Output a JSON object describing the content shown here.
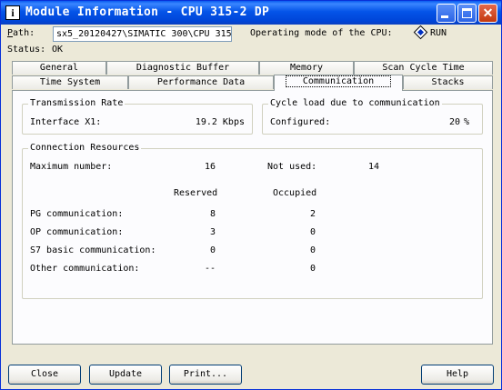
{
  "window": {
    "title": "Module Information - CPU 315-2 DP",
    "close_glyph": "✕"
  },
  "path": {
    "label": "Path:",
    "value": "sx5_20120427\\SIMATIC 300\\CPU 315"
  },
  "mode": {
    "label": "Operating mode of the  CPU:",
    "value": "RUN"
  },
  "status": {
    "label": "Status:",
    "value": "OK"
  },
  "tabs": {
    "row1": [
      "General",
      "Diagnostic Buffer",
      "Memory",
      "Scan Cycle Time"
    ],
    "row2": [
      "Time System",
      "Performance Data",
      "Communication",
      "Stacks"
    ],
    "active": "Communication"
  },
  "transmission": {
    "title": "Transmission Rate",
    "label": "Interface X1:",
    "value": "19.2  Kbps"
  },
  "cycle_load": {
    "title": "Cycle load due to communication",
    "label": "Configured:",
    "value": "20",
    "unit": "%"
  },
  "resources": {
    "title": "Connection Resources",
    "max_label": "Maximum number:",
    "max_value": "16",
    "notused_label": "Not used:",
    "notused_value": "14",
    "col_reserved": "Reserved",
    "col_occupied": "Occupied",
    "rows": [
      {
        "label": "PG communication:",
        "reserved": "8",
        "occupied": "2"
      },
      {
        "label": "OP communication:",
        "reserved": "3",
        "occupied": "0"
      },
      {
        "label": "S7 basic communication:",
        "reserved": "0",
        "occupied": "0"
      },
      {
        "label": "Other communication:",
        "reserved": "--",
        "occupied": "0"
      }
    ]
  },
  "buttons": {
    "close": "Close",
    "update": "Update",
    "print": "Print...",
    "help": "Help"
  },
  "colors": {
    "titlebar": "#0454e8",
    "face": "#ece9d8",
    "run_indicator": "#0030c0"
  }
}
